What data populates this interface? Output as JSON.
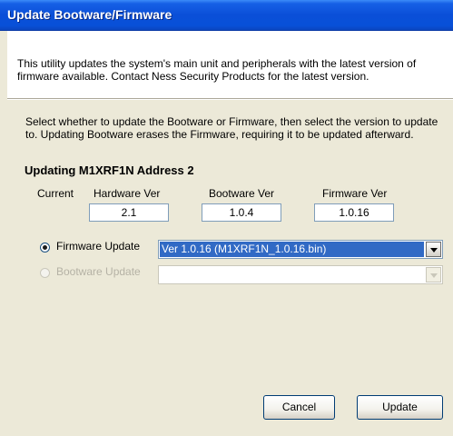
{
  "window": {
    "title": "Update Bootware/Firmware"
  },
  "intro": "This utility updates the system's main unit and peripherals with the latest version of firmware available.  Contact Ness Security Products for the latest version.",
  "instructions": "Select whether to update the Bootware or Firmware, then select the version to update to.  Updating Bootware erases the Firmware, requiring it to be updated afterward.",
  "device": {
    "title": "Updating M1XRF1N Address 2",
    "current_label": "Current",
    "hardware": {
      "label": "Hardware Ver",
      "value": "2.1"
    },
    "bootware": {
      "label": "Bootware Ver",
      "value": "1.0.4"
    },
    "firmware": {
      "label": "Firmware Ver",
      "value": "1.0.16"
    }
  },
  "options": {
    "firmware_update": {
      "label": "Firmware Update",
      "selected": true,
      "value": "Ver 1.0.16 (M1XRF1N_1.0.16.bin)"
    },
    "bootware_update": {
      "label": "Bootware Update",
      "selected": false,
      "enabled": false,
      "value": ""
    }
  },
  "buttons": {
    "cancel": "Cancel",
    "update": "Update"
  },
  "colors": {
    "titlebar": "#0a4fd8",
    "dialog_bg": "#ece9d8",
    "selection": "#316ac5"
  }
}
